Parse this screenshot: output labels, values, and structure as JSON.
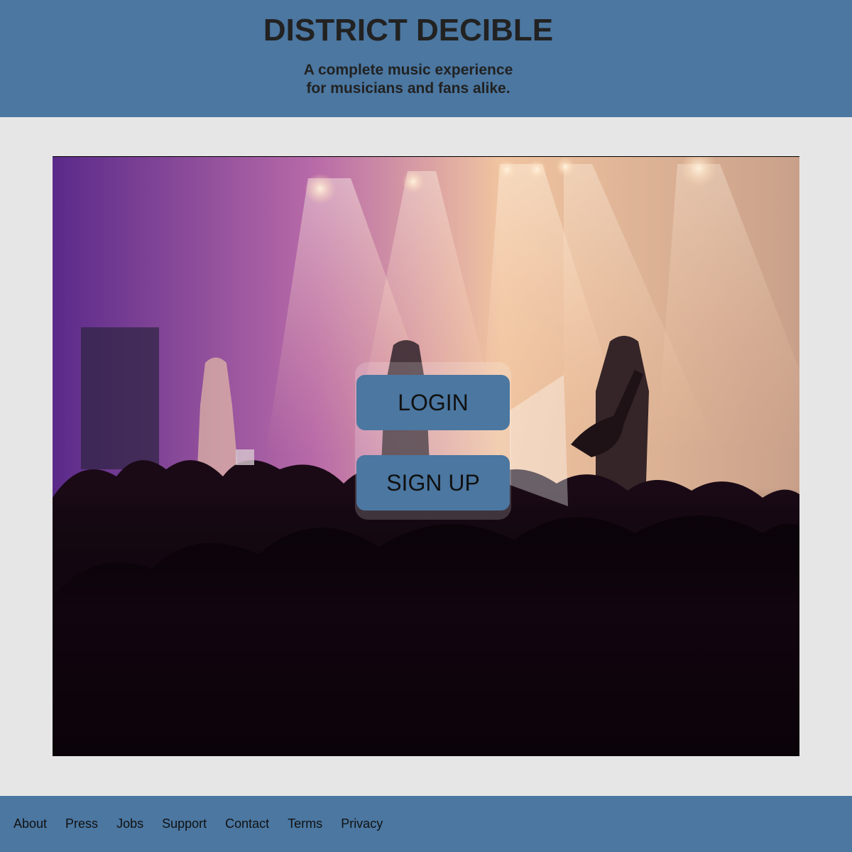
{
  "header": {
    "title": "DISTRICT DECIBLE",
    "tagline_line1": "A complete music experience",
    "tagline_line2": "for musicians and fans alike."
  },
  "hero": {
    "media": "concert-video",
    "login_label": "LOGIN",
    "signup_label": "SIGN UP"
  },
  "footer": {
    "links": [
      "About",
      "Press",
      "Jobs",
      "Support",
      "Contact",
      "Terms",
      "Privacy"
    ]
  },
  "colors": {
    "brand": "#4b77a1",
    "background": "#e6e6e6",
    "text": "#222222"
  }
}
